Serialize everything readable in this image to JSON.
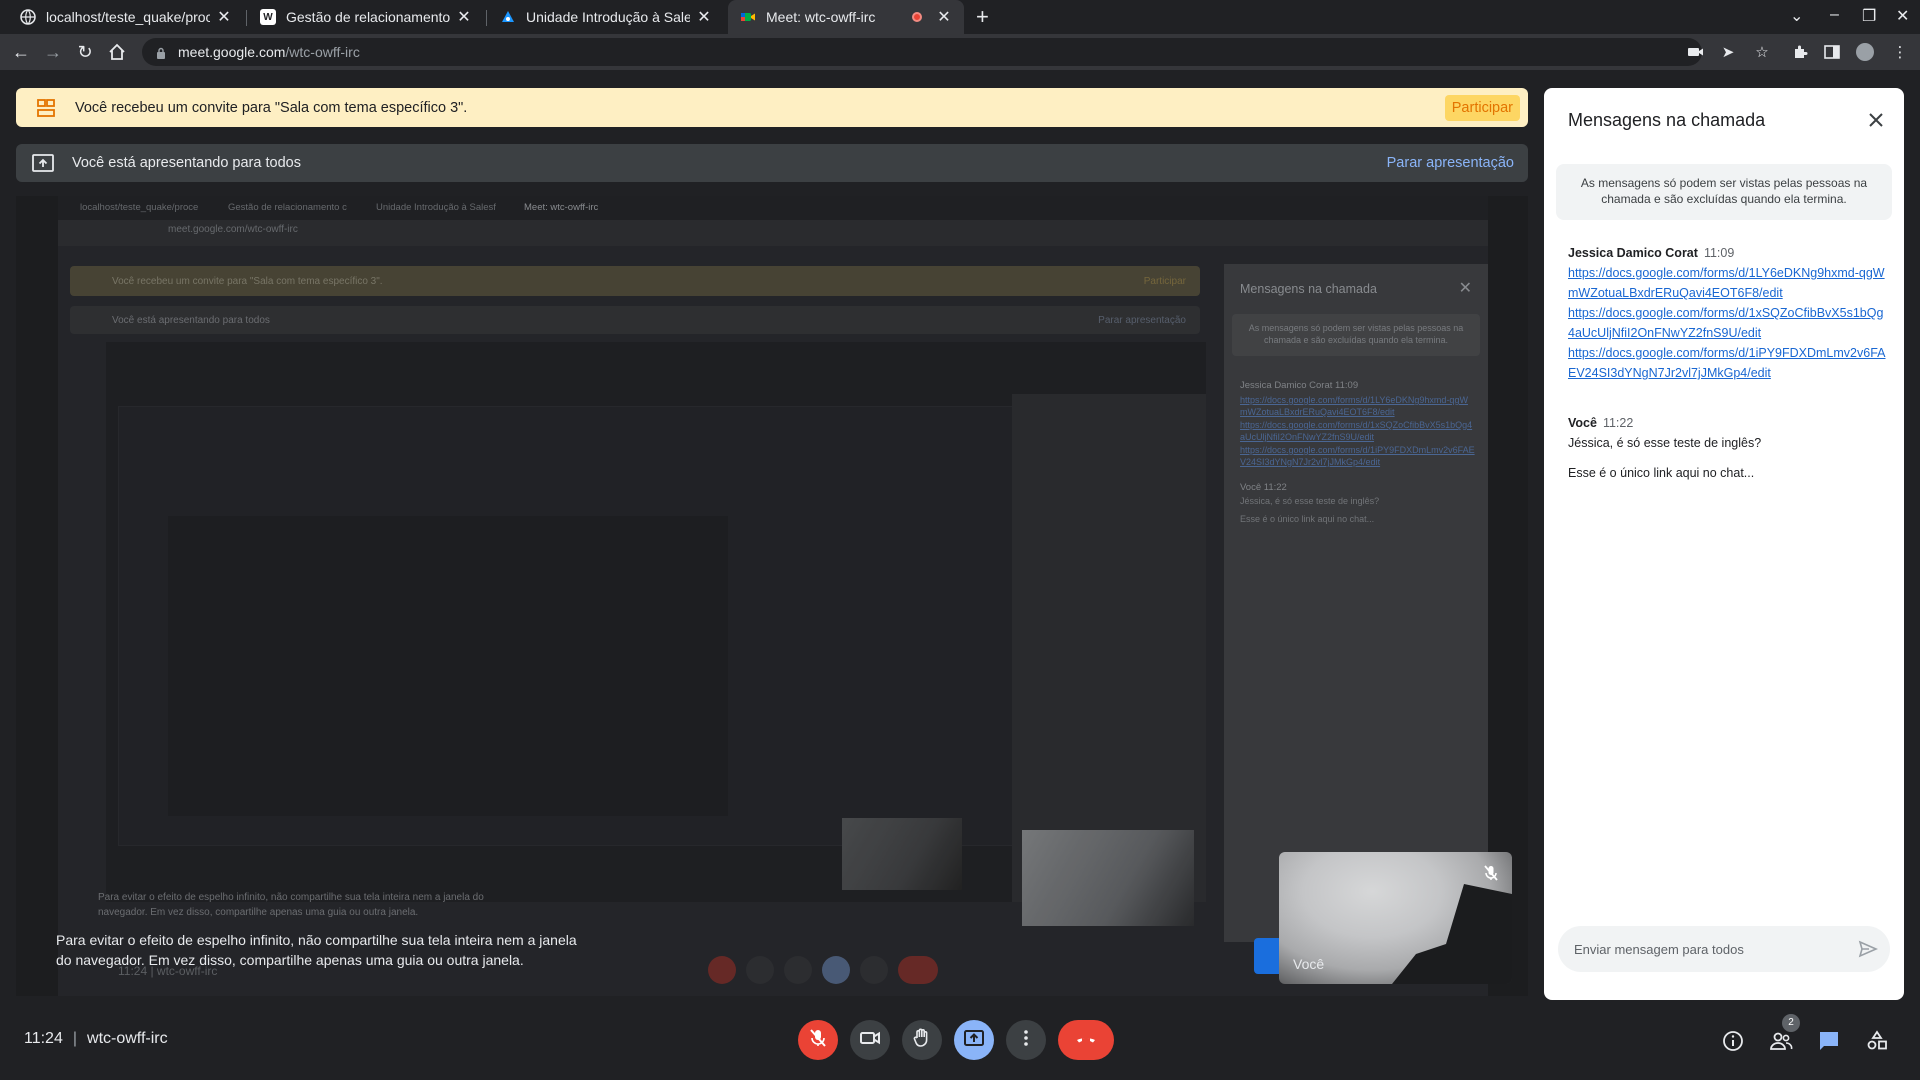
{
  "browser": {
    "tabs": [
      {
        "title": "localhost/teste_quake/proces",
        "favicon": "globe-icon"
      },
      {
        "title": "Gestão de relacionamento co",
        "favicon": "w-icon"
      },
      {
        "title": "Unidade Introdução à Salesfo",
        "favicon": "salesforce-icon"
      },
      {
        "title": "Meet: wtc-owff-irc",
        "favicon": "meet-icon",
        "active": true
      }
    ],
    "url_host": "meet.google.com",
    "url_path": "/wtc-owff-irc"
  },
  "banner": {
    "invite_text": "Você recebeu um convite para \"Sala com tema específico 3\".",
    "join_label": "Participar",
    "presenting_text": "Você está apresentando para todos",
    "stop_label": "Parar apresentação"
  },
  "mirror": {
    "tab1": "localhost/teste_quake/proce",
    "tab2": "Gestão de relacionamento c",
    "tab3": "Unidade Introdução à Salesf",
    "tab4": "Meet: wtc-owff-irc",
    "url": "meet.google.com/wtc-owff-irc",
    "invite": "Você recebeu um convite para \"Sala com tema específico 3\".",
    "join": "Participar",
    "presenting": "Você está apresentando para todos",
    "stop": "Parar apresentação",
    "chat_title": "Mensagens na chamada",
    "chat_note": "As mensagens só podem ser vistas pelas pessoas na chamada e são excluídas quando ela termina.",
    "author1": "Jessica Damico Corat  11:09",
    "link1": "https://docs.google.com/forms/d/1LY6eDKNg9hxmd-qgWmWZotuaLBxdrERuQavi4EOT6F8/edit",
    "link2": "https://docs.google.com/forms/d/1xSQZoCfibBvX5s1bQg4aUcUljNfiI2OnFNwYZ2fnS9U/edit",
    "link3": "https://docs.google.com/forms/d/1iPY9FDXDmLmv2v6FAEV24SI3dYNgN7Jr2vl7jJMkGp4/edit",
    "author2": "Você  11:22",
    "line1": "Jéssica, é só esse teste de inglês?",
    "line2": "Esse é o único link aqui no chat...",
    "parar": "Parar",
    "clock": "11:24  |  wtc-owff-irc",
    "warning": "Para evitar o efeito de espelho infinito, não compartilhe sua tela inteira nem a janela do navegador. Em vez disso, compartilhe apenas uma guia ou outra janela."
  },
  "warning": {
    "line1": "Para evitar o efeito de espelho infinito, não compartilhe sua tela inteira nem a janela",
    "line2": "do navegador. Em vez disso, compartilhe apenas uma guia ou outra janela."
  },
  "self_tile": {
    "name": "Você"
  },
  "chat": {
    "title": "Mensagens na chamada",
    "note": "As mensagens só podem ser vistas pelas pessoas na chamada e são excluídas quando ela termina.",
    "messages": [
      {
        "author": "Jessica Damico Corat",
        "time": "11:09",
        "links": [
          "https://docs.google.com/forms/d/1LY6eDKNg9hxmd-qgWmWZotuaLBxdrERuQavi4EOT6F8/edit",
          "https://docs.google.com/forms/d/1xSQZoCfibBvX5s1bQg4aUcUljNfiI2OnFNwYZ2fnS9U/edit",
          "https://docs.google.com/forms/d/1iPY9FDXDmLmv2v6FAEV24SI3dYNgN7Jr2vl7jJMkGp4/edit"
        ]
      },
      {
        "author": "Você",
        "time": "11:22",
        "lines": [
          "Jéssica, é só esse teste de inglês?",
          "Esse é o único link aqui no chat..."
        ]
      }
    ],
    "input_placeholder": "Enviar mensagem para todos"
  },
  "bottom": {
    "time": "11:24",
    "meeting_code": "wtc-owff-irc",
    "participants_count": "2"
  },
  "colors": {
    "accent_blue": "#8ab4f8",
    "hangup_red": "#ea4335",
    "invite_yellow": "#feefc3",
    "link_blue": "#1967d2"
  }
}
